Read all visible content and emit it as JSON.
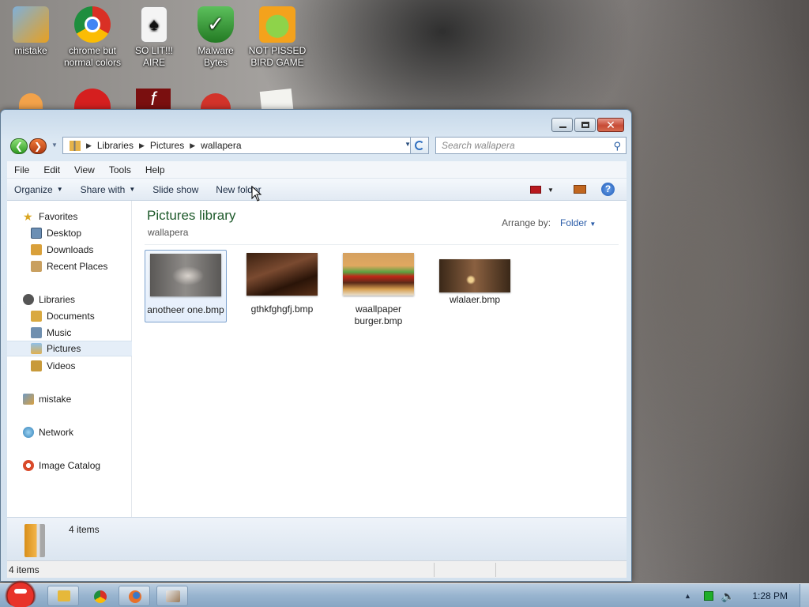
{
  "desktop": {
    "icons": [
      {
        "label": "mistake",
        "icon": "computer-user-icon",
        "color": "#e8a020"
      },
      {
        "label": "chrome but normal colors",
        "icon": "chrome-icon",
        "color": "#2e7d32"
      },
      {
        "label": "SO LIT!!! AIRE",
        "icon": "solitaire-icon",
        "color": "#dcdcdc"
      },
      {
        "label": "Malware Bytes",
        "icon": "malwarebytes-icon",
        "color": "#3a9a3a"
      },
      {
        "label": "NOT PISSED BIRD GAME",
        "icon": "bad-piggies-icon",
        "color": "#f4a21c"
      }
    ]
  },
  "window": {
    "breadcrumb": [
      "Libraries",
      "Pictures",
      "wallapera"
    ],
    "search_placeholder": "Search wallapera",
    "menu": [
      "File",
      "Edit",
      "View",
      "Tools",
      "Help"
    ],
    "commands": {
      "organize": "Organize",
      "share_with": "Share with",
      "slide_show": "Slide show",
      "new_folder": "New folder"
    },
    "nav": {
      "favorites": "Favorites",
      "desktop": "Desktop",
      "downloads": "Downloads",
      "recent_places": "Recent Places",
      "libraries": "Libraries",
      "documents": "Documents",
      "music": "Music",
      "pictures": "Pictures",
      "videos": "Videos",
      "homegroup": "mistake",
      "network": "Network",
      "image_catalog": "Image Catalog"
    },
    "library_title": "Pictures library",
    "library_subtitle": "wallapera",
    "arrange_label": "Arrange by:",
    "arrange_value": "Folder",
    "files": [
      {
        "name": "anotheer one.bmp",
        "selected": true
      },
      {
        "name": "gthkfghgfj.bmp",
        "selected": false
      },
      {
        "name": "waallpaper burger.bmp",
        "selected": false
      },
      {
        "name": "wlalaer.bmp",
        "selected": false
      }
    ],
    "details_count": "4 items",
    "status_count": "4 items"
  },
  "taskbar": {
    "clock": "1:28 PM"
  }
}
